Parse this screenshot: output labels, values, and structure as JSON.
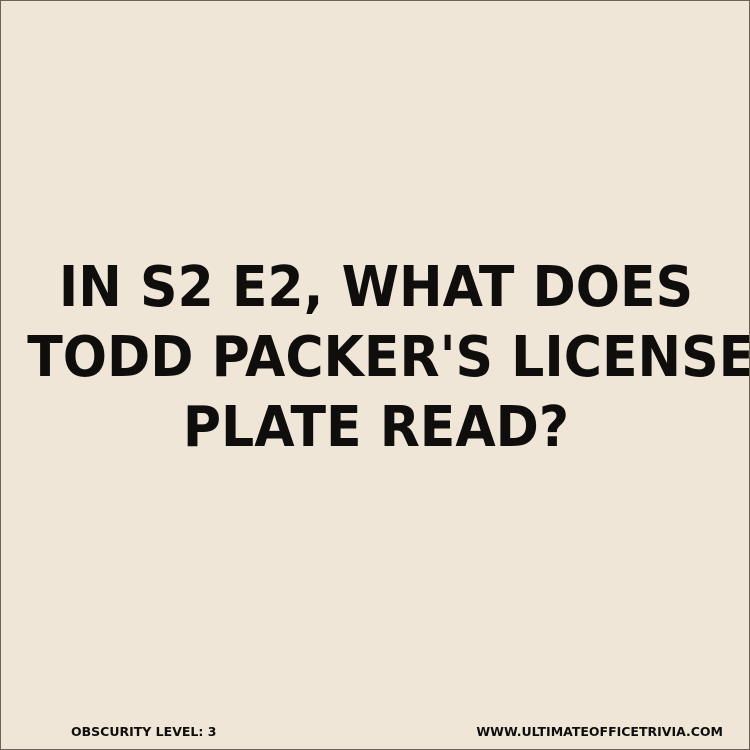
{
  "question": {
    "lines": [
      "IN S2 E2, WHAT DOES",
      "TODD PACKER'S LICENSE",
      "PLATE READ?"
    ]
  },
  "footer": {
    "obscurity": "OBSCURITY LEVEL: 3",
    "website": "WWW.ULTIMATEOFFICETRIVIA.COM"
  },
  "colors": {
    "background": "#efe6d8",
    "text": "#0f0e0d"
  }
}
